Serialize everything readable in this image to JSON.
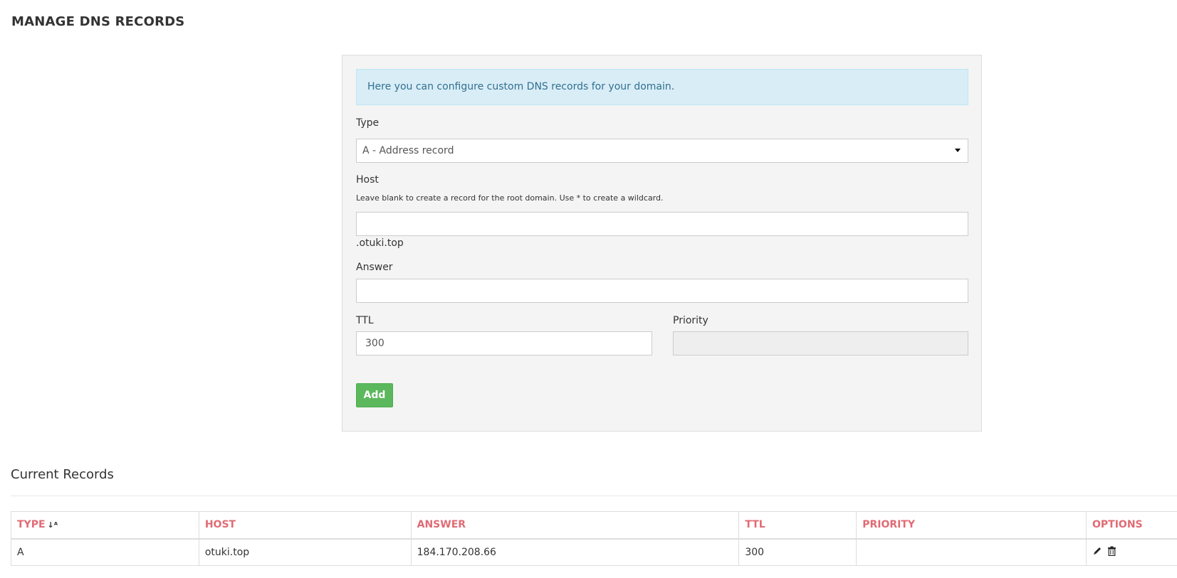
{
  "page": {
    "title": "MANAGE DNS RECORDS"
  },
  "form": {
    "info_text": "Here you can configure custom DNS records for your domain.",
    "type_label": "Type",
    "type_value": "A - Address record",
    "host_label": "Host",
    "host_help": "Leave blank to create a record for the root domain. Use * to create a wildcard.",
    "host_value": "",
    "host_suffix": ".otuki.top",
    "answer_label": "Answer",
    "answer_value": "",
    "ttl_label": "TTL",
    "ttl_value": "300",
    "priority_label": "Priority",
    "priority_value": "",
    "add_button": "Add"
  },
  "records": {
    "section_title": "Current Records",
    "columns": [
      "TYPE",
      "HOST",
      "ANSWER",
      "TTL",
      "PRIORITY",
      "OPTIONS"
    ],
    "sort_icon": "↓ᴬ",
    "rows": [
      {
        "type": "A",
        "host": "otuki.top",
        "answer": "184.170.208.66",
        "ttl": "300",
        "priority": ""
      }
    ]
  },
  "icons": {
    "sort": "sort-alpha-icon",
    "edit": "pencil-icon",
    "delete": "trash-icon"
  },
  "colors": {
    "alert_bg": "#d9edf7",
    "alert_text": "#31708f",
    "header_text": "#e06b74",
    "button_green": "#5cb85c",
    "panel_bg": "#f4f4f4"
  }
}
